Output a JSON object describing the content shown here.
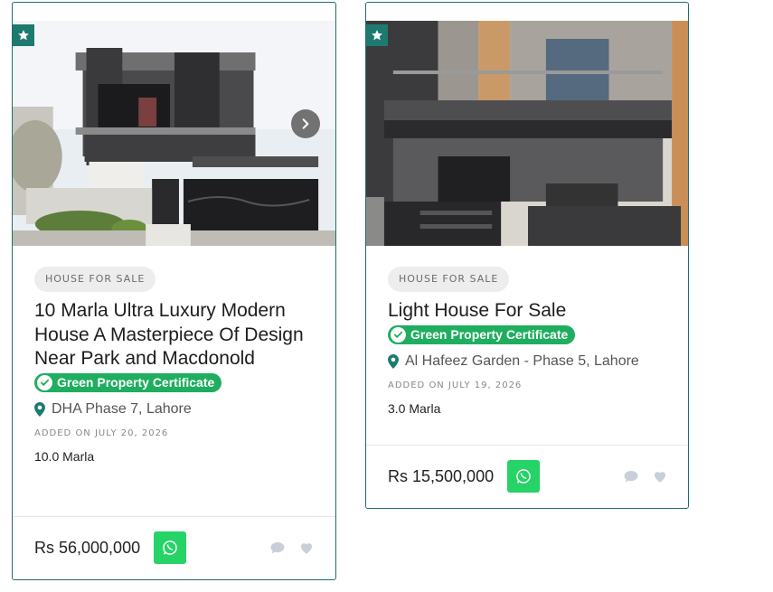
{
  "listings": [
    {
      "category_label": "HOUSE FOR SALE",
      "title": "10 Marla Ultra Luxury Modern House A Masterpiece Of Design Near Park and Macdonold",
      "certificate_label": "Green Property Certificate",
      "location": "DHA Phase 7, Lahore",
      "added_date": "ADDED ON JULY 20, 2026",
      "size": "10.0 Marla",
      "price": "Rs 56,000,000",
      "icons": [
        "star-icon",
        "chevron-right-icon",
        "map-marker-icon",
        "check-circle-icon",
        "whatsapp-icon",
        "comment-icon",
        "heart-icon"
      ]
    },
    {
      "category_label": "HOUSE FOR SALE",
      "title": "Light House For Sale",
      "certificate_label": "Green Property Certificate",
      "location": "Al Hafeez Garden - Phase 5, Lahore",
      "added_date": "ADDED ON JULY 19, 2026",
      "size": "3.0 Marla",
      "price": "Rs 15,500,000",
      "icons": [
        "star-icon",
        "map-marker-icon",
        "check-circle-icon",
        "whatsapp-icon",
        "comment-icon",
        "heart-icon"
      ]
    }
  ],
  "colors": {
    "accent": "#1d7a70",
    "certificate_green": "#1fae5f",
    "whatsapp_green": "#25d366",
    "border": "#1f6f6a"
  }
}
